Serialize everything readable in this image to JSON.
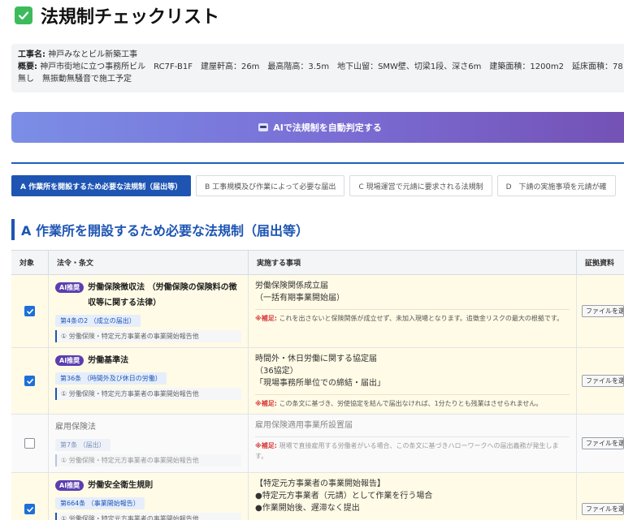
{
  "header": {
    "title": "法規制チェックリスト",
    "icon": "check-icon"
  },
  "project": {
    "name_label": "工事名:",
    "name_value": "神戸みなとビル新築工事",
    "summary_label": "概要:",
    "summary_value": "神戸市街地に立つ事務所ビル　RC7F-B1F　建屋軒高：26m　最高階高：3.5m　地下山留：SMW壁、切梁1段、深さ6m　建築面積：1200m2　延床面積：78",
    "summary_cont": "無し　無振動無騒音で施工予定"
  },
  "ai_button": {
    "label": "AIで法規制を自動判定する",
    "icon": "robot-icon"
  },
  "tabs": [
    {
      "label": "A 作業所を開設するため必要な法規制（届出等）",
      "active": true
    },
    {
      "label": "B 工事規模及び作業によって必要な届出",
      "active": false
    },
    {
      "label": "C 現場運営で元請に要求される法規制",
      "active": false
    },
    {
      "label": "D　下請の実施事項を元請が確",
      "active": false
    }
  ],
  "section": {
    "title": "A 作業所を開設するため必要な法規制（届出等）"
  },
  "table": {
    "headers": [
      "対象",
      "法令・条文",
      "実施する事項",
      "証拠資料"
    ],
    "rows": [
      {
        "checked": true,
        "ai": true,
        "ai_label": "AI推奨",
        "law": "労働保険徴収法 （労働保険の保険料の徴収等に関する法律）",
        "article": "第4条の2 （成立の届出）",
        "procedure": "① 労働保険・特定元方事業者の事業開始報告他",
        "implement": "労働保険関係成立届\n（一括有期事業開始届）",
        "note_label": "※補足:",
        "note": "これを出さないと保険関係が成立せず、未加入現場となります。追徴金リスクの最大の根拠です。",
        "file_label": "ファイルを選択"
      },
      {
        "checked": true,
        "ai": true,
        "ai_label": "AI推奨",
        "law": "労働基準法",
        "article": "第36条 （時間外及び休日の労働）",
        "procedure": "① 労働保険・特定元方事業者の事業開始報告他",
        "implement": "時間外・休日労働に関する協定届\n（36協定）\n「現場事務所単位での締結・届出」",
        "note_label": "※補足:",
        "note": "この条文に基づき、労使協定を結んで届出なければ、1分たりとも残業はさせられません。",
        "file_label": "ファイルを選択"
      },
      {
        "checked": false,
        "ai": false,
        "ai_label": "",
        "law": "雇用保険法",
        "article": "第7条 （届出）",
        "procedure": "① 労働保険・特定元方事業者の事業開始報告他",
        "implement": "雇用保険適用事業所設置届",
        "note_label": "※補足:",
        "note": "現場で直接雇用する労働者がいる場合、この条文に基づきハローワークへの届出義務が発生します。",
        "file_label": "ファイルを選択"
      },
      {
        "checked": true,
        "ai": true,
        "ai_label": "AI推奨",
        "law": "労働安全衛生規則",
        "article": "第664条 （事業開始報告）",
        "procedure": "① 労働保険・特定元方事業者の事業開始報告他",
        "implement": "【特定元方事業者の事業開始報告】\n●特定元方事業者（元請）として作業を行う場合\n●作業開始後、遅滞なく提出",
        "note_label": "",
        "note": "",
        "file_label": "ファイルを選択"
      }
    ]
  },
  "colors": {
    "accent": "#1e55b3",
    "ai_badge": "#5b3fb0",
    "row_highlight": "#fffbe6",
    "note_red": "#d63b3b"
  }
}
